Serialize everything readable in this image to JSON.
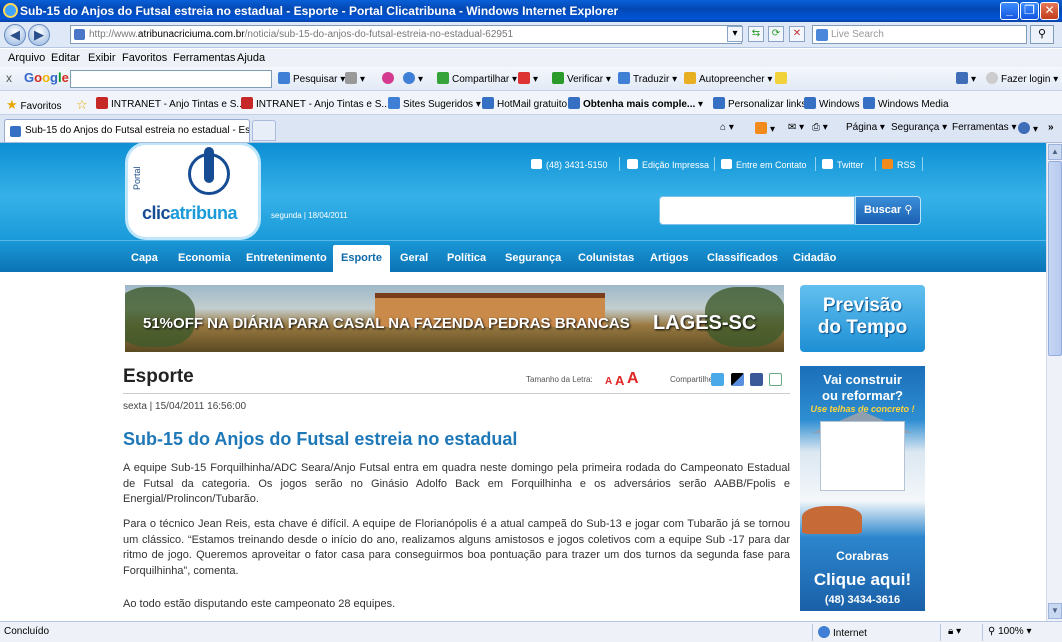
{
  "window": {
    "title": "Sub-15 do Anjos do Futsal estreia no estadual - Esporte - Portal Clicatribuna - Windows Internet Explorer",
    "minimize": "_",
    "maximize": "❐",
    "close": "✕"
  },
  "address": {
    "url_prefix": "http://www.",
    "url_domain": "atribunacriciuma.com.br",
    "url_path": "/noticia/sub-15-do-anjos-do-futsal-estreia-no-estadual-62951",
    "live_search_placeholder": "Live Search"
  },
  "menu": [
    "Arquivo",
    "Editar",
    "Exibir",
    "Favoritos",
    "Ferramentas",
    "Ajuda"
  ],
  "google_toolbar": {
    "logo": "Google",
    "items": [
      "Pesquisar",
      "Compartilhar",
      "Verificar",
      "Traduzir",
      "Autopreencher",
      "Fazer login"
    ]
  },
  "favorites": {
    "label": "Favoritos",
    "items": [
      "INTRANET - Anjo Tintas e S...",
      "INTRANET - Anjo Tintas e S...",
      "Sites Sugeridos",
      "HotMail gratuito",
      "Obtenha mais comple...",
      "Personalizar links",
      "Windows",
      "Windows Media"
    ]
  },
  "tab": {
    "title": "Sub-15 do Anjos do Futsal estreia no estadual - Espor..."
  },
  "commandbar": [
    "Página",
    "Segurança",
    "Ferramentas"
  ],
  "site": {
    "logo_portal": "Portal",
    "logo_clic": "clic",
    "logo_atribuna": "atribuna",
    "header_date": "segunda | 18/04/2011",
    "toplinks": [
      "(48) 3431-5150",
      "Edição Impressa",
      "Entre em Contato",
      "Twitter",
      "RSS"
    ],
    "search_button": "Buscar",
    "nav": [
      "Capa",
      "Economia",
      "Entretenimento",
      "Esporte",
      "Geral",
      "Política",
      "Segurança",
      "Colunistas",
      "Artigos",
      "Classificados",
      "Cidadão"
    ],
    "nav_active": "Esporte"
  },
  "banner": {
    "text": "51%OFF NA DIÁRIA PARA CASAL NA FAZENDA PEDRAS BRANCAS",
    "text2": "LAGES-SC"
  },
  "ads": {
    "previsao_line1": "Previsão",
    "previsao_line2": "do Tempo",
    "corabras_line1": "Vai construir",
    "corabras_line2": "ou reformar?",
    "corabras_line3": "Use telhas de concreto !",
    "corabras_brand": "Corabras",
    "corabras_cta": "Clique aqui!",
    "corabras_phone": "(48) 3434-3616"
  },
  "article": {
    "section": "Esporte",
    "font_size_label": "Tamanho da Letra:",
    "font_size_options": [
      "A",
      "A",
      "A"
    ],
    "share_label": "Compartilhe:",
    "datetime": "sexta | 15/04/2011 16:56:00",
    "headline": "Sub-15 do Anjos do Futsal estreia no estadual",
    "paragraphs": [
      "A equipe Sub-15 Forquilhinha/ADC Seara/Anjo Futsal entra em quadra neste domingo pela primeira rodada do Campeonato Estadual de Futsal da categoria. Os jogos serão no Ginásio Adolfo Back em Forquilhinha e os adversários serão AABB/Fpolis e Energial/Prolincon/Tubarão.",
      "Para o técnico Jean Reis, esta chave é difícil. A equipe de Florianópolis é a atual campeã do Sub-13 e jogar com Tubarão já se tornou um clássico. “Estamos treinando desde o início do ano, realizamos alguns amistosos e jogos coletivos com a equipe Sub -17 para dar ritmo de jogo. Queremos aproveitar o fator casa para conseguirmos boa pontuação para trazer um dos turnos da segunda fase para Forquilhinha”, comenta.",
      "Ao todo estão disputando este campeonato 28 equipes."
    ]
  },
  "status": {
    "left": "Concluído",
    "zone": "Internet",
    "zoom": "100%"
  }
}
